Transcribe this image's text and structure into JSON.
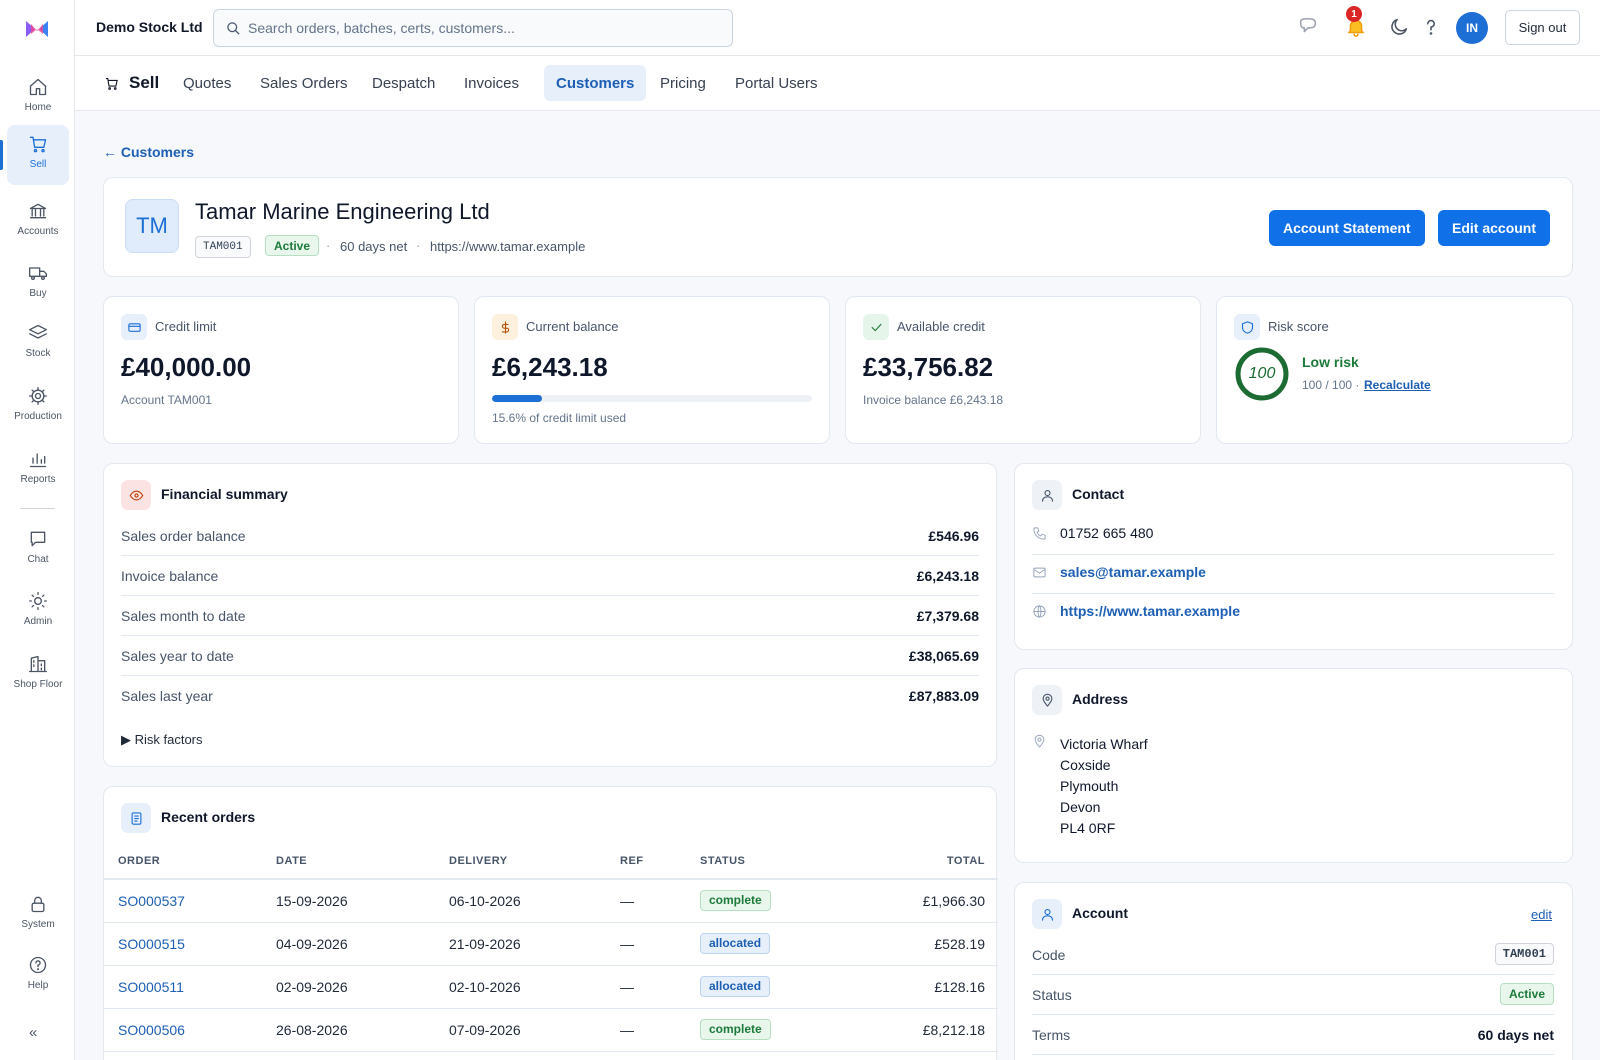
{
  "topbar": {
    "company": "Demo Stock Ltd",
    "search_placeholder": "Search orders, batches, certs, customers...",
    "notification_count": "1",
    "avatar_initials": "IN",
    "sign_out_label": "Sign out"
  },
  "sidebar": {
    "items": [
      {
        "label": "Home",
        "icon": "home-icon"
      },
      {
        "label": "Sell",
        "icon": "cart-icon",
        "active": true
      },
      {
        "label": "Accounts",
        "icon": "bank-icon"
      },
      {
        "label": "Buy",
        "icon": "truck-icon"
      },
      {
        "label": "Stock",
        "icon": "layers-icon"
      },
      {
        "label": "Production",
        "icon": "gear-icon"
      },
      {
        "label": "Reports",
        "icon": "bar-chart-icon"
      },
      {
        "label": "Chat",
        "icon": "chat-icon"
      },
      {
        "label": "Admin",
        "icon": "sun-icon"
      },
      {
        "label": "Shop Floor",
        "icon": "building-icon"
      },
      {
        "label": "System",
        "icon": "lock-icon"
      },
      {
        "label": "Help",
        "icon": "help-circle-icon"
      }
    ],
    "collapse_label": "«"
  },
  "subnav": {
    "title": "Sell",
    "tabs": [
      "Quotes",
      "Sales Orders",
      "Despatch",
      "Invoices",
      "Customers",
      "Pricing",
      "Portal Users"
    ],
    "active_tab": "Customers"
  },
  "back_link": "← Customers",
  "customer": {
    "initials": "TM",
    "name": "Tamar Marine Engineering Ltd",
    "code": "TAM001",
    "status": "Active",
    "terms": "60 days net",
    "website": "https://www.tamar.example",
    "account_statement_label": "Account Statement",
    "edit_account_label": "Edit account"
  },
  "stats": {
    "credit_limit": {
      "label": "Credit limit",
      "value": "£40,000.00",
      "sub": "Account TAM001"
    },
    "current_balance": {
      "label": "Current balance",
      "value": "£6,243.18",
      "usage_fraction": 0.156,
      "sub": "15.6% of credit limit used"
    },
    "available_credit": {
      "label": "Available credit",
      "value": "£33,756.82",
      "sub": "Invoice balance £6,243.18"
    },
    "risk": {
      "label": "Risk score",
      "score": "100",
      "score_value": 100,
      "level": "Low risk",
      "score_text": "100 / 100 ·",
      "recalculate_label": "Recalculate"
    }
  },
  "financial_summary": {
    "title": "Financial summary",
    "rows": [
      {
        "label": "Sales order balance",
        "value": "£546.96"
      },
      {
        "label": "Invoice balance",
        "value": "£6,243.18"
      },
      {
        "label": "Sales month to date",
        "value": "£7,379.68"
      },
      {
        "label": "Sales year to date",
        "value": "£38,065.69"
      },
      {
        "label": "Sales last year",
        "value": "£87,883.09"
      }
    ],
    "risk_factors_label": "▶ Risk factors"
  },
  "recent_orders": {
    "title": "Recent orders",
    "columns": [
      "ORDER",
      "DATE",
      "DELIVERY",
      "REF",
      "STATUS",
      "TOTAL"
    ],
    "rows": [
      {
        "order": "SO000537",
        "date": "15-09-2026",
        "delivery": "06-10-2026",
        "ref": "—",
        "status": "complete",
        "total": "£1,966.30"
      },
      {
        "order": "SO000515",
        "date": "04-09-2026",
        "delivery": "21-09-2026",
        "ref": "—",
        "status": "allocated",
        "total": "£528.19"
      },
      {
        "order": "SO000511",
        "date": "02-09-2026",
        "delivery": "02-10-2026",
        "ref": "—",
        "status": "allocated",
        "total": "£128.16"
      },
      {
        "order": "SO000506",
        "date": "26-08-2026",
        "delivery": "07-09-2026",
        "ref": "—",
        "status": "complete",
        "total": "£8,212.18"
      }
    ]
  },
  "contact": {
    "title": "Contact",
    "phone": "01752 665 480",
    "email": "sales@tamar.example",
    "website": "https://www.tamar.example"
  },
  "address": {
    "title": "Address",
    "lines": [
      "Victoria Wharf",
      "Coxside",
      "Plymouth",
      "Devon",
      "PL4 0RF"
    ]
  },
  "account": {
    "title": "Account",
    "edit_label": "edit",
    "code_label": "Code",
    "code": "TAM001",
    "status_label": "Status",
    "status": "Active",
    "terms_label": "Terms",
    "terms": "60 days net"
  },
  "colors": {
    "accent": "#1070e8",
    "success": "#1c7a3a",
    "danger": "#dc2626"
  }
}
